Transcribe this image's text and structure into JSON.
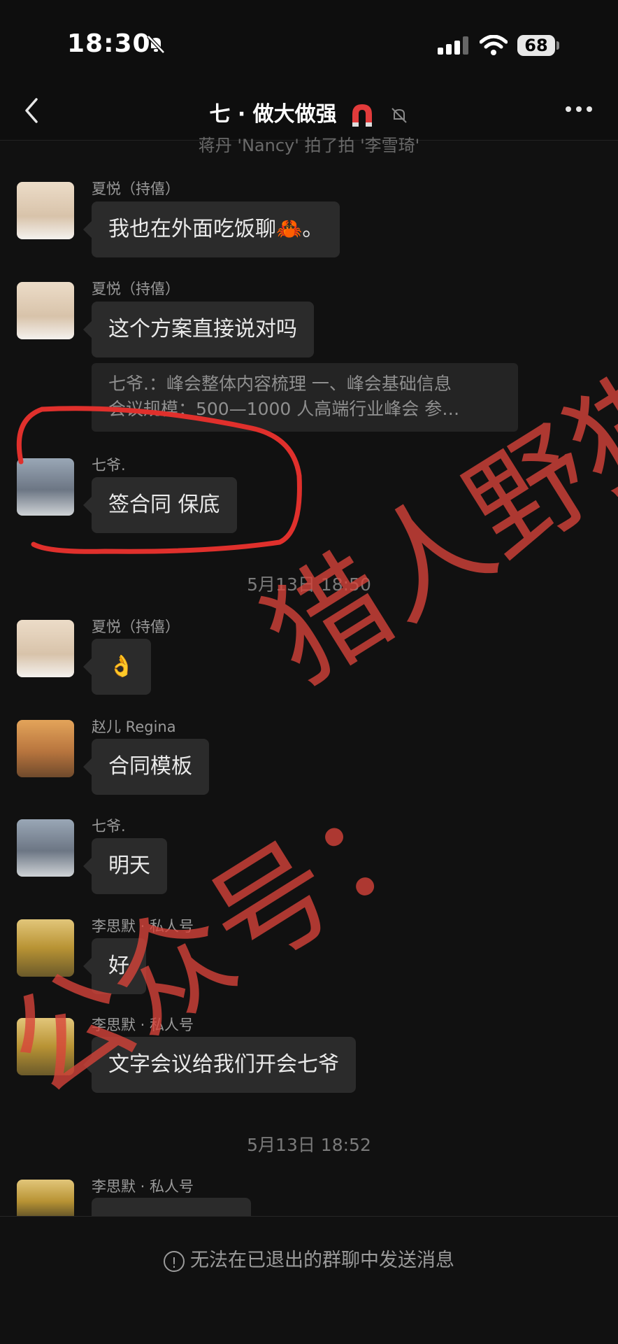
{
  "status": {
    "time": "18:30",
    "battery": "68"
  },
  "header": {
    "title": "七 · 做大做强"
  },
  "system_notice": "蒋丹 'Nancy' 拍了拍 '李雪琦'",
  "messages": [
    {
      "name": "夏悦（持僖）",
      "text": "我也在外面吃饭聊🦀。"
    },
    {
      "name": "夏悦（持僖）",
      "text": "这个方案直接说对吗",
      "quote_line1": "七爷.：峰会整体内容梳理 一、峰会基础信息",
      "quote_line2": "会议规模：500—1000 人高端行业峰会 参…"
    },
    {
      "name": "七爷.",
      "text": "签合同 保底"
    },
    {
      "name": "夏悦（持僖）",
      "text": "👌"
    },
    {
      "name": "赵儿 Regina",
      "text": "合同模板"
    },
    {
      "name": "七爷.",
      "text": "明天"
    },
    {
      "name": "李思默 · 私人号",
      "text": "好"
    },
    {
      "name": "李思默 · 私人号",
      "text": "文字会议给我们开会七爷"
    },
    {
      "name": "李思默 · 私人号",
      "text": ""
    }
  ],
  "timestamps": [
    "5月13日 18:50",
    "5月13日 18:52"
  ],
  "footer": {
    "notice": "无法在已退出的群聊中发送消息"
  },
  "watermark": {
    "line1": "猎人野猫",
    "line2": "公众号："
  },
  "colors": {
    "background": "#111111",
    "bubble": "#2b2b2b",
    "watermark": "#d9443a"
  }
}
